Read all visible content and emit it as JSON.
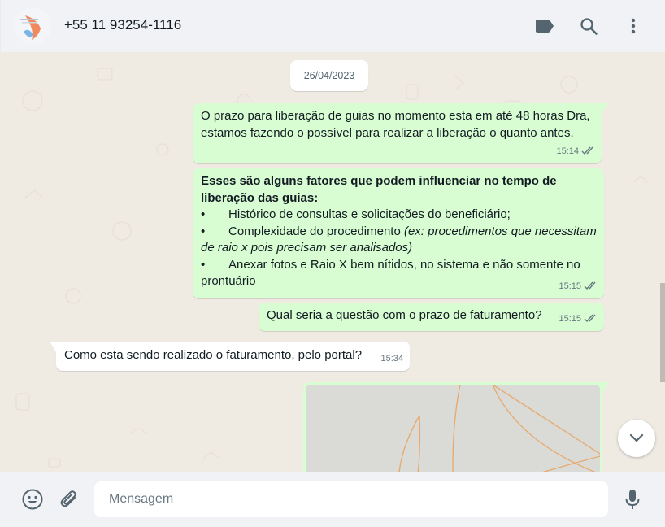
{
  "header": {
    "contact_name": "+55 11 93254-1116",
    "icons": [
      "label-icon",
      "search-icon",
      "menu-icon"
    ]
  },
  "chat": {
    "date": "26/04/2023",
    "messages": [
      {
        "direction": "outgoing",
        "text": "O prazo para liberação de guias no momento esta em até 48 horas Dra, estamos fazendo o possível para realizar a liberação o quanto antes.",
        "time": "15:14",
        "status": "read"
      },
      {
        "direction": "outgoing",
        "heading": "Esses são alguns fatores que podem influenciar no tempo de liberação das guias:",
        "bullets": [
          {
            "symbol": "•",
            "text": "Histórico de consultas e solicitações do beneficiário;"
          },
          {
            "symbol": "•",
            "text": "Complexidade do procedimento ",
            "italic": "(ex: procedimentos que necessitam de raio x pois precisam ser analisados)"
          },
          {
            "symbol": "•",
            "text": "Anexar fotos e Raio X bem nítidos, no sistema e não somente no prontuário"
          }
        ],
        "time": "15:15",
        "status": "read"
      },
      {
        "direction": "outgoing",
        "text": "Qual seria a questão com o prazo de faturamento?",
        "time": "15:15",
        "status": "read"
      },
      {
        "direction": "incoming",
        "text": "Como esta sendo realizado o faturamento, pelo portal?",
        "time": "15:34"
      },
      {
        "direction": "outgoing",
        "type": "image"
      }
    ]
  },
  "composer": {
    "placeholder": "Mensagem",
    "icons": [
      "emoji-icon",
      "attach-icon",
      "microphone-icon"
    ]
  },
  "colors": {
    "outgoing_bubble": "#d9fdd3",
    "incoming_bubble": "#ffffff",
    "chat_background": "#efeae2",
    "header_background": "#f0f2f5",
    "read_ticks": "#667781"
  }
}
